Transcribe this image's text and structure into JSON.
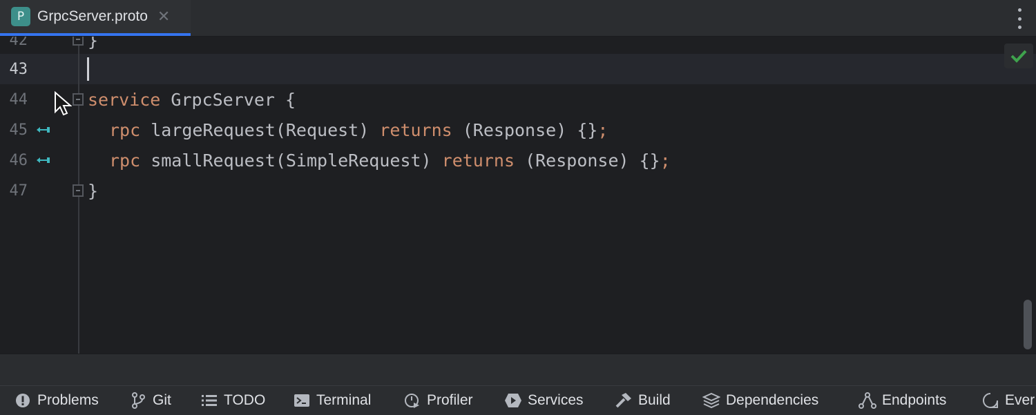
{
  "tab": {
    "file_icon_letter": "P",
    "title": "GrpcServer.proto"
  },
  "editor": {
    "lines": [
      {
        "number": "42",
        "code": "}"
      },
      {
        "number": "43",
        "code": ""
      },
      {
        "number": "44",
        "keyword": "service",
        "code": " GrpcServer {"
      },
      {
        "number": "45",
        "kw1": "rpc",
        "mid": " largeRequest(Request) ",
        "kw2": "returns",
        "tail": " (Response) {}",
        "semi": ";"
      },
      {
        "number": "46",
        "kw1": "rpc",
        "mid": " smallRequest(SimpleRequest) ",
        "kw2": "returns",
        "tail": " (Response) {}",
        "semi": ";"
      },
      {
        "number": "47",
        "code": "}"
      }
    ]
  },
  "toolwindows": [
    {
      "label": "Problems",
      "icon": "problems-icon"
    },
    {
      "label": "Git",
      "icon": "git-branch-icon"
    },
    {
      "label": "TODO",
      "icon": "todo-list-icon"
    },
    {
      "label": "Terminal",
      "icon": "terminal-icon"
    },
    {
      "label": "Profiler",
      "icon": "profiler-icon"
    },
    {
      "label": "Services",
      "icon": "services-icon"
    },
    {
      "label": "Build",
      "icon": "build-hammer-icon"
    },
    {
      "label": "Dependencies",
      "icon": "dependencies-icon"
    },
    {
      "label": "Endpoints",
      "icon": "endpoints-icon"
    },
    {
      "label": "Ever",
      "icon": "event-log-icon"
    }
  ],
  "colors": {
    "keyword": "#cf8e6d",
    "text": "#bcbec4",
    "accent": "#3574f0",
    "check": "#3fa34d",
    "gutter_arrow": "#3fb8c0"
  }
}
